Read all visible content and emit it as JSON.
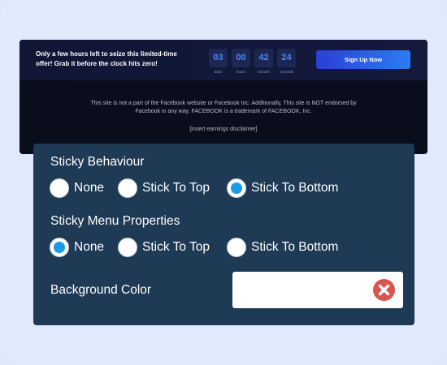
{
  "preview": {
    "offer_line1": "Only a few hours left to seize this limited-time",
    "offer_line2": "offer! Grab it before the clock hits zero!",
    "countdown": [
      {
        "value": "03",
        "label": "days"
      },
      {
        "value": "00",
        "label": "hours"
      },
      {
        "value": "42",
        "label": "minutes"
      },
      {
        "value": "24",
        "label": "seconds"
      }
    ],
    "signup_label": "Sign Up Now",
    "footer_line1": "This site is not a part of the Facebook website or Facebook Inc. Additionally, This site is NOT endorsed by",
    "footer_line2": "Facebook in any way. FACEBOOK is a trademark of FACEBOOK, Inc.",
    "disclaimer": "[insert earnings disclaimer]"
  },
  "settings": {
    "sticky_behaviour": {
      "title": "Sticky Behaviour",
      "options": [
        "None",
        "Stick To Top",
        "Stick To Bottom"
      ],
      "selected": "Stick To Bottom"
    },
    "sticky_menu": {
      "title": "Sticky Menu Properties",
      "options": [
        "None",
        "Stick To Top",
        "Stick To Bottom"
      ],
      "selected": "None"
    },
    "background_color": {
      "label": "Background Color",
      "value": ""
    }
  },
  "colors": {
    "panel": "#1e3a55",
    "radio_selected": "#1a9be3",
    "clear_button": "#d9534f",
    "countdown_digits": "#4f86ff",
    "signup_gradient_start": "#2a3fd6",
    "signup_gradient_end": "#2c7cf2"
  },
  "icons": {
    "clear": "close-icon"
  }
}
